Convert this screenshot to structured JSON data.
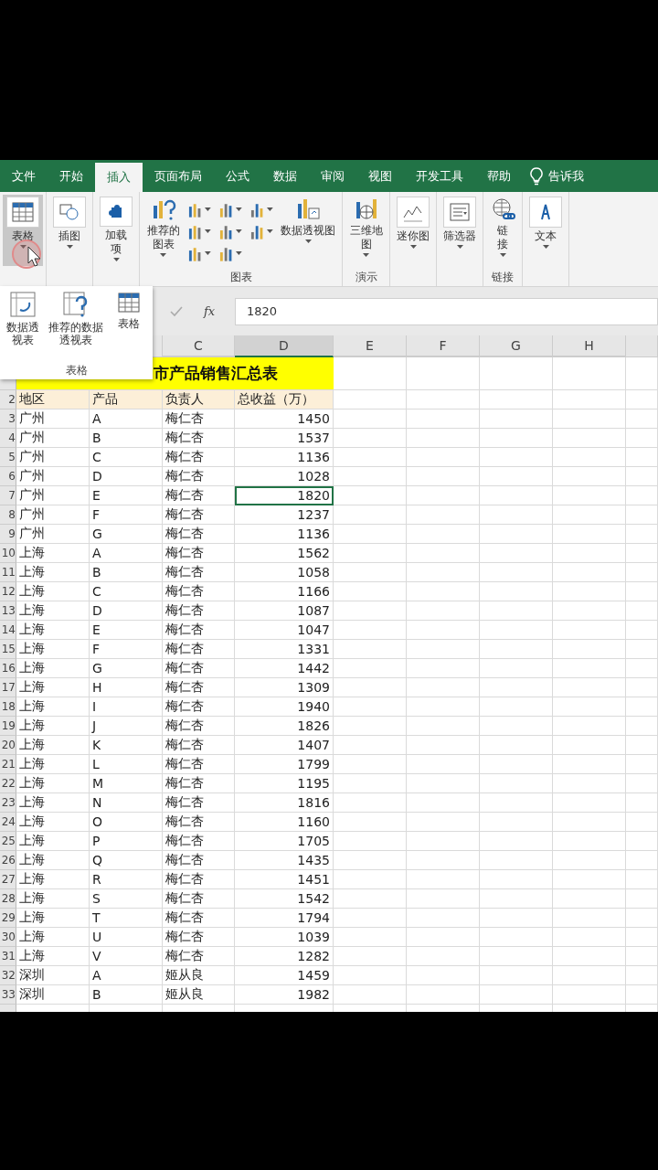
{
  "tabs": [
    {
      "label": "文件",
      "selected": false
    },
    {
      "label": "开始",
      "selected": false
    },
    {
      "label": "插入",
      "selected": true
    },
    {
      "label": "页面布局",
      "selected": false
    },
    {
      "label": "公式",
      "selected": false
    },
    {
      "label": "数据",
      "selected": false
    },
    {
      "label": "审阅",
      "selected": false
    },
    {
      "label": "视图",
      "selected": false
    },
    {
      "label": "开发工具",
      "selected": false
    },
    {
      "label": "帮助",
      "selected": false
    }
  ],
  "tell_me": "告诉我",
  "ribbon_groups": [
    {
      "items": [
        {
          "kind": "table",
          "label": "表格",
          "selected": true
        }
      ]
    },
    {
      "items": [
        {
          "kind": "illustrations",
          "label": "插图",
          "selected": false
        }
      ]
    },
    {
      "items": [
        {
          "kind": "addins",
          "label": "加载项",
          "selected": false
        }
      ]
    },
    {
      "label": "图表",
      "items": [
        {
          "kind": "recommended-charts",
          "label": "推荐的图表",
          "selected": false
        },
        {
          "kind": "chart-gallery",
          "selected": false
        },
        {
          "kind": "pivot-chart",
          "label": "数据透视图",
          "selected": false
        }
      ]
    },
    {
      "label": "演示",
      "items": [
        {
          "kind": "map",
          "label": "三维地图",
          "selected": false
        }
      ]
    },
    {
      "items": [
        {
          "kind": "sparkline",
          "label": "迷你图",
          "selected": false
        }
      ]
    },
    {
      "items": [
        {
          "kind": "slicer",
          "label": "筛选器",
          "selected": false
        }
      ]
    },
    {
      "label": "链接",
      "items": [
        {
          "kind": "link",
          "label": "链接",
          "selected": false
        }
      ]
    },
    {
      "items": [
        {
          "kind": "text",
          "label": "文本",
          "selected": false
        }
      ]
    }
  ],
  "dropdown": {
    "label": "表格",
    "items": [
      {
        "kind": "pivot",
        "label": "数据透视表"
      },
      {
        "kind": "recommended-pivot",
        "label": "推荐的数据透视表"
      },
      {
        "kind": "table",
        "label": "表格"
      }
    ]
  },
  "formula_bar": {
    "fx": "fx",
    "value": "1820"
  },
  "column_headers": [
    {
      "label": "C",
      "selected": false
    },
    {
      "label": "D",
      "selected": true
    },
    {
      "label": "E",
      "selected": false
    },
    {
      "label": "F",
      "selected": false
    },
    {
      "label": "G",
      "selected": false
    },
    {
      "label": "H",
      "selected": false
    }
  ],
  "title_row": {
    "title": "市产品销售汇总表"
  },
  "header_row": {
    "n": "2",
    "cells": [
      "地区",
      "产品",
      "负责人",
      "总收益（万）"
    ]
  },
  "rows": [
    {
      "n": "3",
      "region": "广州",
      "product": "A",
      "owner": "梅仁杏",
      "revenue": "1450",
      "selected": false
    },
    {
      "n": "4",
      "region": "广州",
      "product": "B",
      "owner": "梅仁杏",
      "revenue": "1537",
      "selected": false
    },
    {
      "n": "5",
      "region": "广州",
      "product": "C",
      "owner": "梅仁杏",
      "revenue": "1136",
      "selected": false
    },
    {
      "n": "6",
      "region": "广州",
      "product": "D",
      "owner": "梅仁杏",
      "revenue": "1028",
      "selected": false
    },
    {
      "n": "7",
      "region": "广州",
      "product": "E",
      "owner": "梅仁杏",
      "revenue": "1820",
      "selected": true
    },
    {
      "n": "8",
      "region": "广州",
      "product": "F",
      "owner": "梅仁杏",
      "revenue": "1237",
      "selected": false
    },
    {
      "n": "9",
      "region": "广州",
      "product": "G",
      "owner": "梅仁杏",
      "revenue": "1136",
      "selected": false
    },
    {
      "n": "10",
      "region": "上海",
      "product": "A",
      "owner": "梅仁杏",
      "revenue": "1562",
      "selected": false
    },
    {
      "n": "11",
      "region": "上海",
      "product": "B",
      "owner": "梅仁杏",
      "revenue": "1058",
      "selected": false
    },
    {
      "n": "12",
      "region": "上海",
      "product": "C",
      "owner": "梅仁杏",
      "revenue": "1166",
      "selected": false
    },
    {
      "n": "13",
      "region": "上海",
      "product": "D",
      "owner": "梅仁杏",
      "revenue": "1087",
      "selected": false
    },
    {
      "n": "14",
      "region": "上海",
      "product": "E",
      "owner": "梅仁杏",
      "revenue": "1047",
      "selected": false
    },
    {
      "n": "15",
      "region": "上海",
      "product": "F",
      "owner": "梅仁杏",
      "revenue": "1331",
      "selected": false
    },
    {
      "n": "16",
      "region": "上海",
      "product": "G",
      "owner": "梅仁杏",
      "revenue": "1442",
      "selected": false
    },
    {
      "n": "17",
      "region": "上海",
      "product": "H",
      "owner": "梅仁杏",
      "revenue": "1309",
      "selected": false
    },
    {
      "n": "18",
      "region": "上海",
      "product": "I",
      "owner": "梅仁杏",
      "revenue": "1940",
      "selected": false
    },
    {
      "n": "19",
      "region": "上海",
      "product": "J",
      "owner": "梅仁杏",
      "revenue": "1826",
      "selected": false
    },
    {
      "n": "20",
      "region": "上海",
      "product": "K",
      "owner": "梅仁杏",
      "revenue": "1407",
      "selected": false
    },
    {
      "n": "21",
      "region": "上海",
      "product": "L",
      "owner": "梅仁杏",
      "revenue": "1799",
      "selected": false
    },
    {
      "n": "22",
      "region": "上海",
      "product": "M",
      "owner": "梅仁杏",
      "revenue": "1195",
      "selected": false
    },
    {
      "n": "23",
      "region": "上海",
      "product": "N",
      "owner": "梅仁杏",
      "revenue": "1816",
      "selected": false
    },
    {
      "n": "24",
      "region": "上海",
      "product": "O",
      "owner": "梅仁杏",
      "revenue": "1160",
      "selected": false
    },
    {
      "n": "25",
      "region": "上海",
      "product": "P",
      "owner": "梅仁杏",
      "revenue": "1705",
      "selected": false
    },
    {
      "n": "26",
      "region": "上海",
      "product": "Q",
      "owner": "梅仁杏",
      "revenue": "1435",
      "selected": false
    },
    {
      "n": "27",
      "region": "上海",
      "product": "R",
      "owner": "梅仁杏",
      "revenue": "1451",
      "selected": false
    },
    {
      "n": "28",
      "region": "上海",
      "product": "S",
      "owner": "梅仁杏",
      "revenue": "1542",
      "selected": false
    },
    {
      "n": "29",
      "region": "上海",
      "product": "T",
      "owner": "梅仁杏",
      "revenue": "1794",
      "selected": false
    },
    {
      "n": "30",
      "region": "上海",
      "product": "U",
      "owner": "梅仁杏",
      "revenue": "1039",
      "selected": false
    },
    {
      "n": "31",
      "region": "上海",
      "product": "V",
      "owner": "梅仁杏",
      "revenue": "1282",
      "selected": false
    },
    {
      "n": "32",
      "region": "深圳",
      "product": "A",
      "owner": "姬从良",
      "revenue": "1459",
      "selected": false
    },
    {
      "n": "33",
      "region": "深圳",
      "product": "B",
      "owner": "姬从良",
      "revenue": "1982",
      "selected": false
    }
  ]
}
